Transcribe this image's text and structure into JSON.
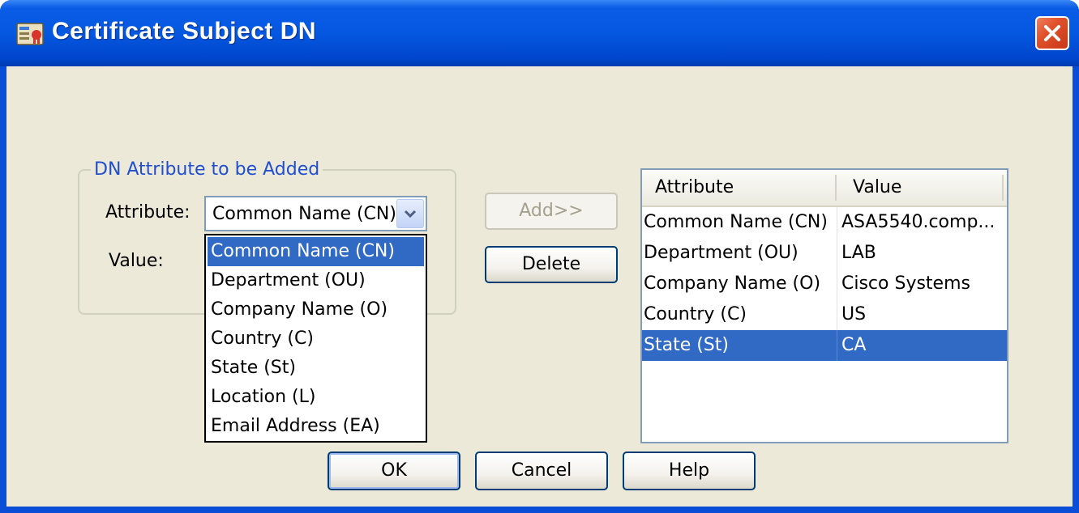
{
  "window": {
    "title": "Certificate Subject DN"
  },
  "group": {
    "legend": "DN Attribute to be Added",
    "attribute_label": "Attribute:",
    "value_label": "Value:",
    "attribute_selected": "Common Name (CN)",
    "options": [
      "Common Name (CN)",
      "Department (OU)",
      "Company Name (O)",
      "Country (C)",
      "State (St)",
      "Location (L)",
      "Email Address (EA)"
    ]
  },
  "buttons": {
    "add": "Add>>",
    "delete": "Delete",
    "ok": "OK",
    "cancel": "Cancel",
    "help": "Help"
  },
  "table": {
    "headers": [
      "Attribute",
      "Value"
    ],
    "rows": [
      {
        "attribute": "Common Name (CN)",
        "value": "ASA5540.comp..."
      },
      {
        "attribute": "Department (OU)",
        "value": "LAB"
      },
      {
        "attribute": "Company Name (O)",
        "value": "Cisco Systems"
      },
      {
        "attribute": "Country (C)",
        "value": "US"
      },
      {
        "attribute": "State (St)",
        "value": "CA"
      }
    ],
    "selected_row": 4
  },
  "colors": {
    "title_blue": "#0558e0",
    "selection": "#316ac5",
    "dialog_bg": "#ece9d8",
    "legend_text": "#1f4ed0"
  }
}
